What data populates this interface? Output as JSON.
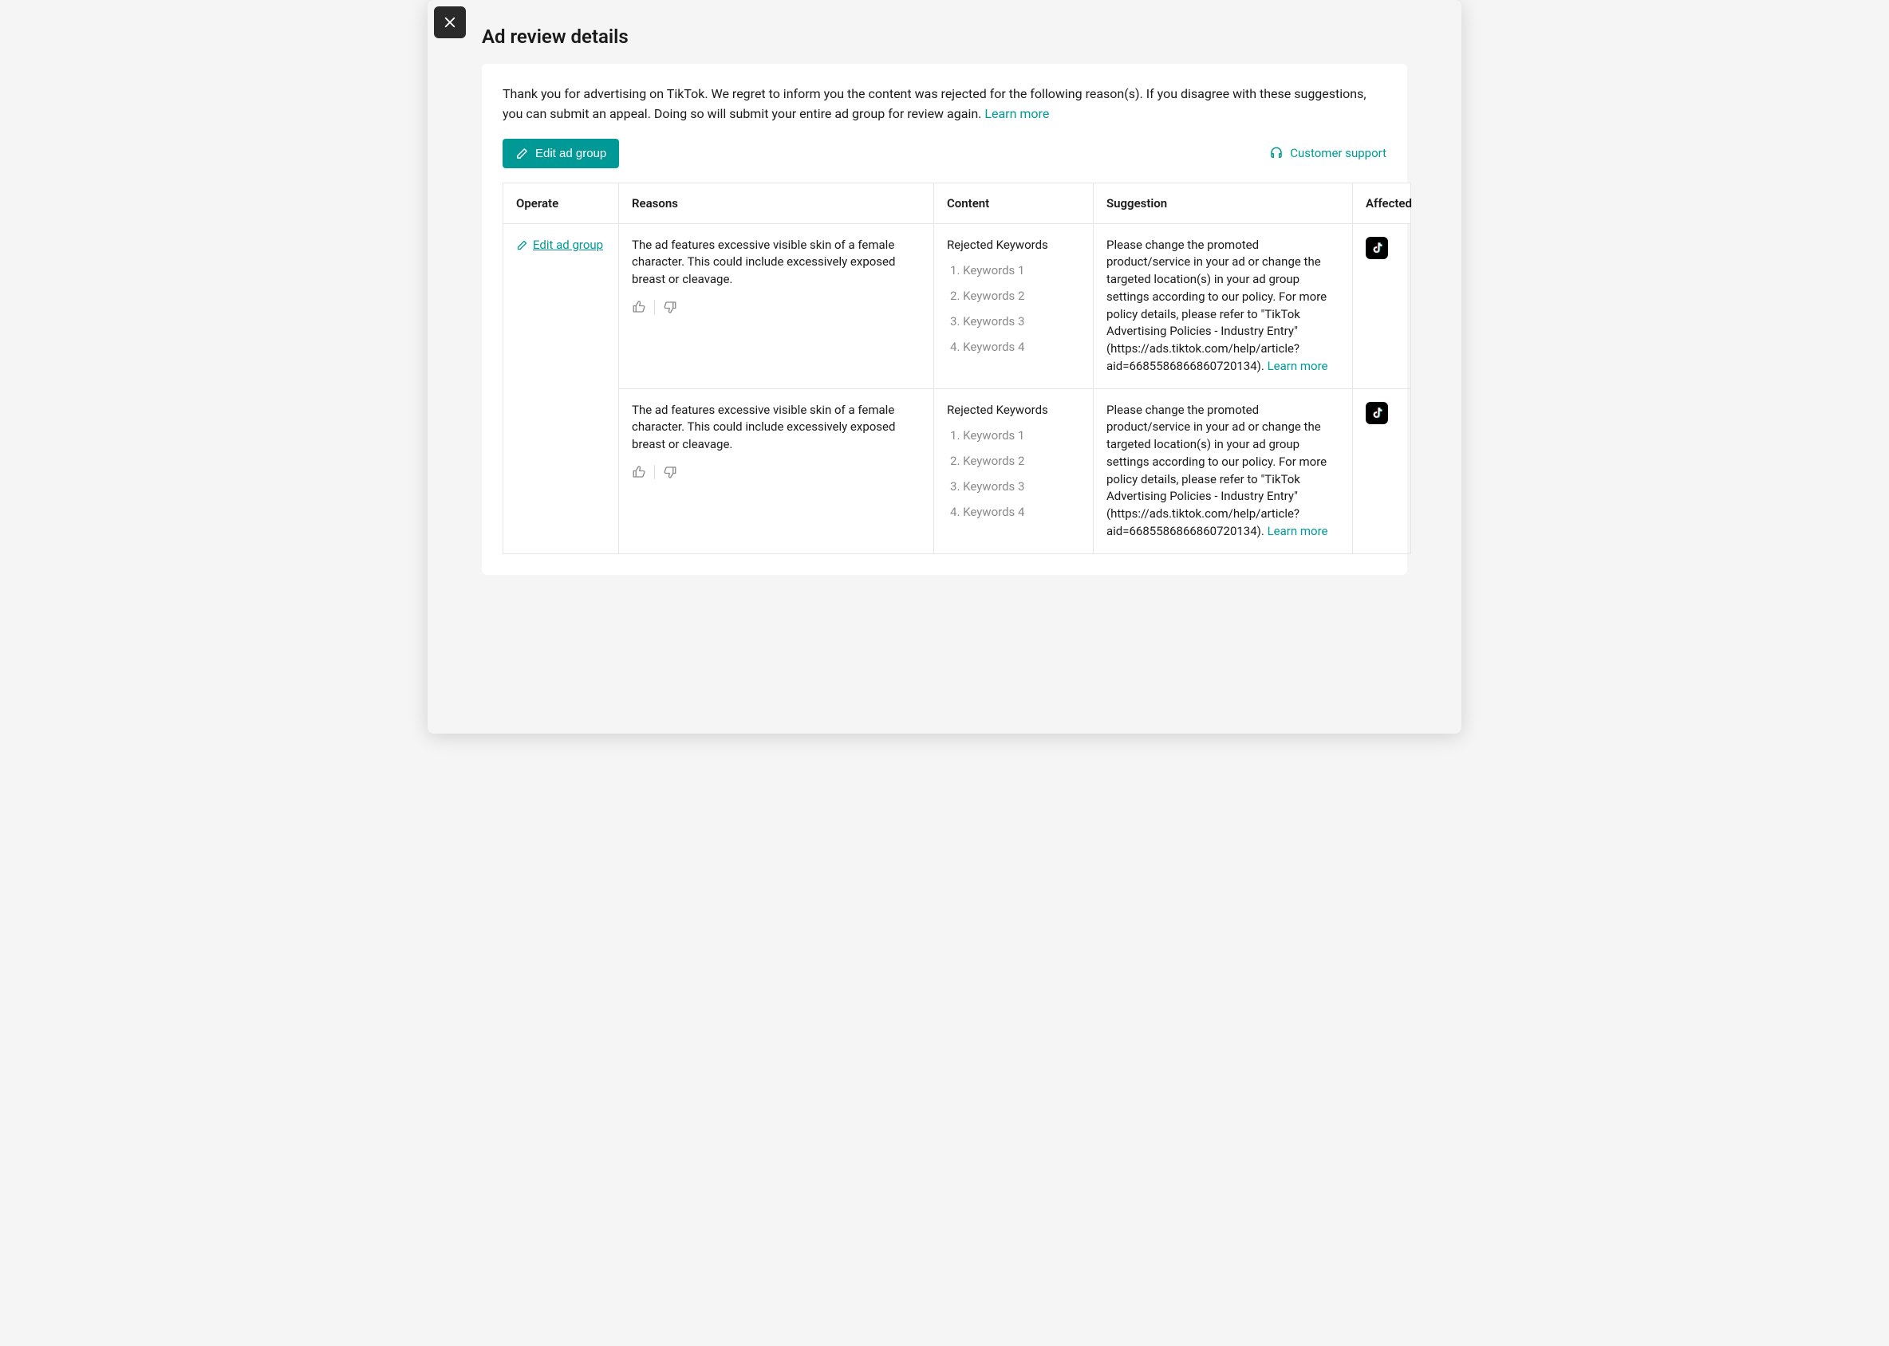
{
  "page": {
    "title": "Ad review details",
    "intro_text": "Thank you for advertising on TikTok. We regret to inform you the content was rejected for the following reason(s). If you  disagree with these suggestions, you can submit an appeal. Doing so will submit your entire ad group for review again. ",
    "learn_more_label": "Learn more"
  },
  "toolbar": {
    "edit_label": "Edit ad group",
    "support_label": "Customer support"
  },
  "table": {
    "headers": {
      "operate": "Operate",
      "reasons": "Reasons",
      "content": "Content",
      "suggestion": "Suggestion",
      "affected": "Affected"
    },
    "operate_link_label": "Edit ad group",
    "rows": [
      {
        "reason": "The ad features excessive visible skin of a female character. This could include excessively exposed breast or cleavage.",
        "content_title": "Rejected Keywords",
        "keywords": [
          "Keywords 1",
          "Keywords 2",
          "Keywords 3",
          "Keywords 4"
        ],
        "suggestion": "Please change the promoted product/service in your ad or change the targeted location(s) in your ad group settings according to our policy. For more policy details, please refer to \"TikTok Advertising Policies - Industry Entry\" (https://ads.tiktok.com/help/article?aid=6685586866860720134). ",
        "suggestion_link": "Learn more"
      },
      {
        "reason": "The ad features excessive visible skin of a female character. This could include excessively exposed breast or cleavage.",
        "content_title": "Rejected Keywords",
        "keywords": [
          "Keywords 1",
          "Keywords 2",
          "Keywords 3",
          "Keywords 4"
        ],
        "suggestion": "Please change the promoted product/service in your ad or change the targeted location(s) in your ad group settings according to our policy. For more policy details, please refer to \"TikTok Advertising Policies - Industry Entry\" (https://ads.tiktok.com/help/article?aid=6685586866860720134). ",
        "suggestion_link": "Learn more"
      }
    ]
  }
}
